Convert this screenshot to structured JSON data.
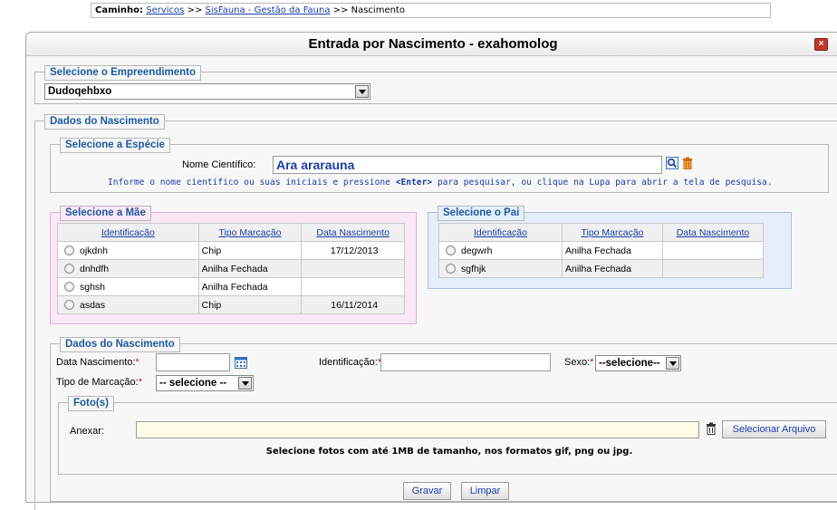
{
  "breadcrumb": {
    "prefix": "Caminho:",
    "link1": "Servicos",
    "sep1": ">>",
    "link2": "SisFauna - Gestão da Fauna",
    "sep2": ">>",
    "current": "Nascimento"
  },
  "window": {
    "title": "Entrada por Nascimento - exahomolog",
    "close_label": "×"
  },
  "empreendimento": {
    "legend": "Selecione o Empreendimento",
    "value": "Dudoqehbxo"
  },
  "nascimento_outer": {
    "legend": "Dados do Nascimento"
  },
  "especie": {
    "legend": "Selecione a Espécie",
    "label": "Nome Científico:",
    "value": "Ara ararauna",
    "help_before": "Informe o nome científico ou suas iniciais e pressione ",
    "help_key": "<Enter>",
    "help_after": " para pesquisar, ou clique na Lupa para abrir a tela de pesquisa."
  },
  "mae": {
    "legend": "Selecione a Mãe",
    "headers": [
      "Identificação",
      "Tipo Marcação",
      "Data Nascimento"
    ],
    "rows": [
      {
        "id": "ojkdnh",
        "tipo": "Chip",
        "data": "17/12/2013"
      },
      {
        "id": "dnhdfh",
        "tipo": "Anilha Fechada",
        "data": ""
      },
      {
        "id": "sghsh",
        "tipo": "Anilha Fechada",
        "data": ""
      },
      {
        "id": "asdas",
        "tipo": "Chip",
        "data": "16/11/2014"
      }
    ]
  },
  "pai": {
    "legend": "Selecione o Pai",
    "headers": [
      "Identificação",
      "Tipo Marcação",
      "Data Nascimento"
    ],
    "rows": [
      {
        "id": "degwrh",
        "tipo": "Anilha Fechada",
        "data": ""
      },
      {
        "id": "sgfhjk",
        "tipo": "Anilha Fechada",
        "data": ""
      }
    ]
  },
  "dados": {
    "legend": "Dados do Nascimento",
    "data_nascimento_label": "Data Nascimento:",
    "identificacao_label": "Identificação:",
    "sexo_label": "Sexo:",
    "sexo_value": "--selecione--",
    "tipo_marcacao_label": "Tipo de Marcação:",
    "tipo_marcacao_value": "-- selecione --",
    "required_mark": "*"
  },
  "fotos": {
    "legend": "Foto(s)",
    "anexar_label": "Anexar:",
    "select_button": "Selecionar Arquivo",
    "note": "Selecione fotos com até 1MB de tamanho, nos formatos gif, png ou jpg."
  },
  "actions": {
    "save": "Gravar",
    "clear": "Limpar"
  },
  "colors": {
    "link": "#1a3ea8",
    "legend": "#1e5a9e",
    "mae_bg": "#fbe8f7",
    "mae_border": "#e6a8dc",
    "pai_bg": "#e6eefb",
    "pai_border": "#a8bde0",
    "upload_bg": "#fdfde8",
    "required": "#dd1111"
  },
  "icons": [
    "close-icon",
    "search-icon",
    "trash-icon",
    "calendar-icon",
    "radio-icon",
    "chevron-down-icon"
  ]
}
